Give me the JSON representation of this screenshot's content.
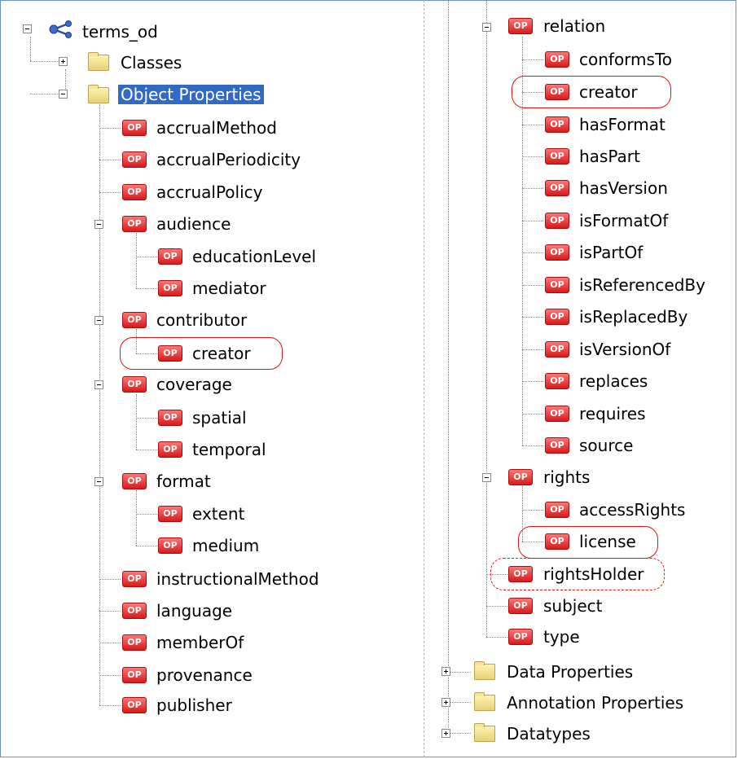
{
  "op_badge": "OP",
  "colors": {
    "selection": "#316ac5",
    "op_badge": "#d81a1a",
    "highlight_oval": "#e81010"
  },
  "left_tree": {
    "root": "terms_od",
    "classes": "Classes",
    "object_properties": "Object Properties",
    "items": {
      "accrualMethod": "accrualMethod",
      "accrualPeriodicity": "accrualPeriodicity",
      "accrualPolicy": "accrualPolicy",
      "audience": "audience",
      "educationLevel": "educationLevel",
      "mediator": "mediator",
      "contributor": "contributor",
      "creator": "creator",
      "coverage": "coverage",
      "spatial": "spatial",
      "temporal": "temporal",
      "format": "format",
      "extent": "extent",
      "medium": "medium",
      "instructionalMethod": "instructionalMethod",
      "language": "language",
      "memberOf": "memberOf",
      "provenance": "provenance",
      "publisher": "publisher"
    }
  },
  "right_tree": {
    "items": {
      "relation": "relation",
      "conformsTo": "conformsTo",
      "creator": "creator",
      "hasFormat": "hasFormat",
      "hasPart": "hasPart",
      "hasVersion": "hasVersion",
      "isFormatOf": "isFormatOf",
      "isPartOf": "isPartOf",
      "isReferencedBy": "isReferencedBy",
      "isReplacedBy": "isReplacedBy",
      "isVersionOf": "isVersionOf",
      "replaces": "replaces",
      "requires": "requires",
      "source": "source",
      "rights": "rights",
      "accessRights": "accessRights",
      "license": "license",
      "rightsHolder": "rightsHolder",
      "subject": "subject",
      "type": "type"
    },
    "data_properties": "Data Properties",
    "annotation_properties": "Annotation Properties",
    "datatypes": "Datatypes"
  }
}
